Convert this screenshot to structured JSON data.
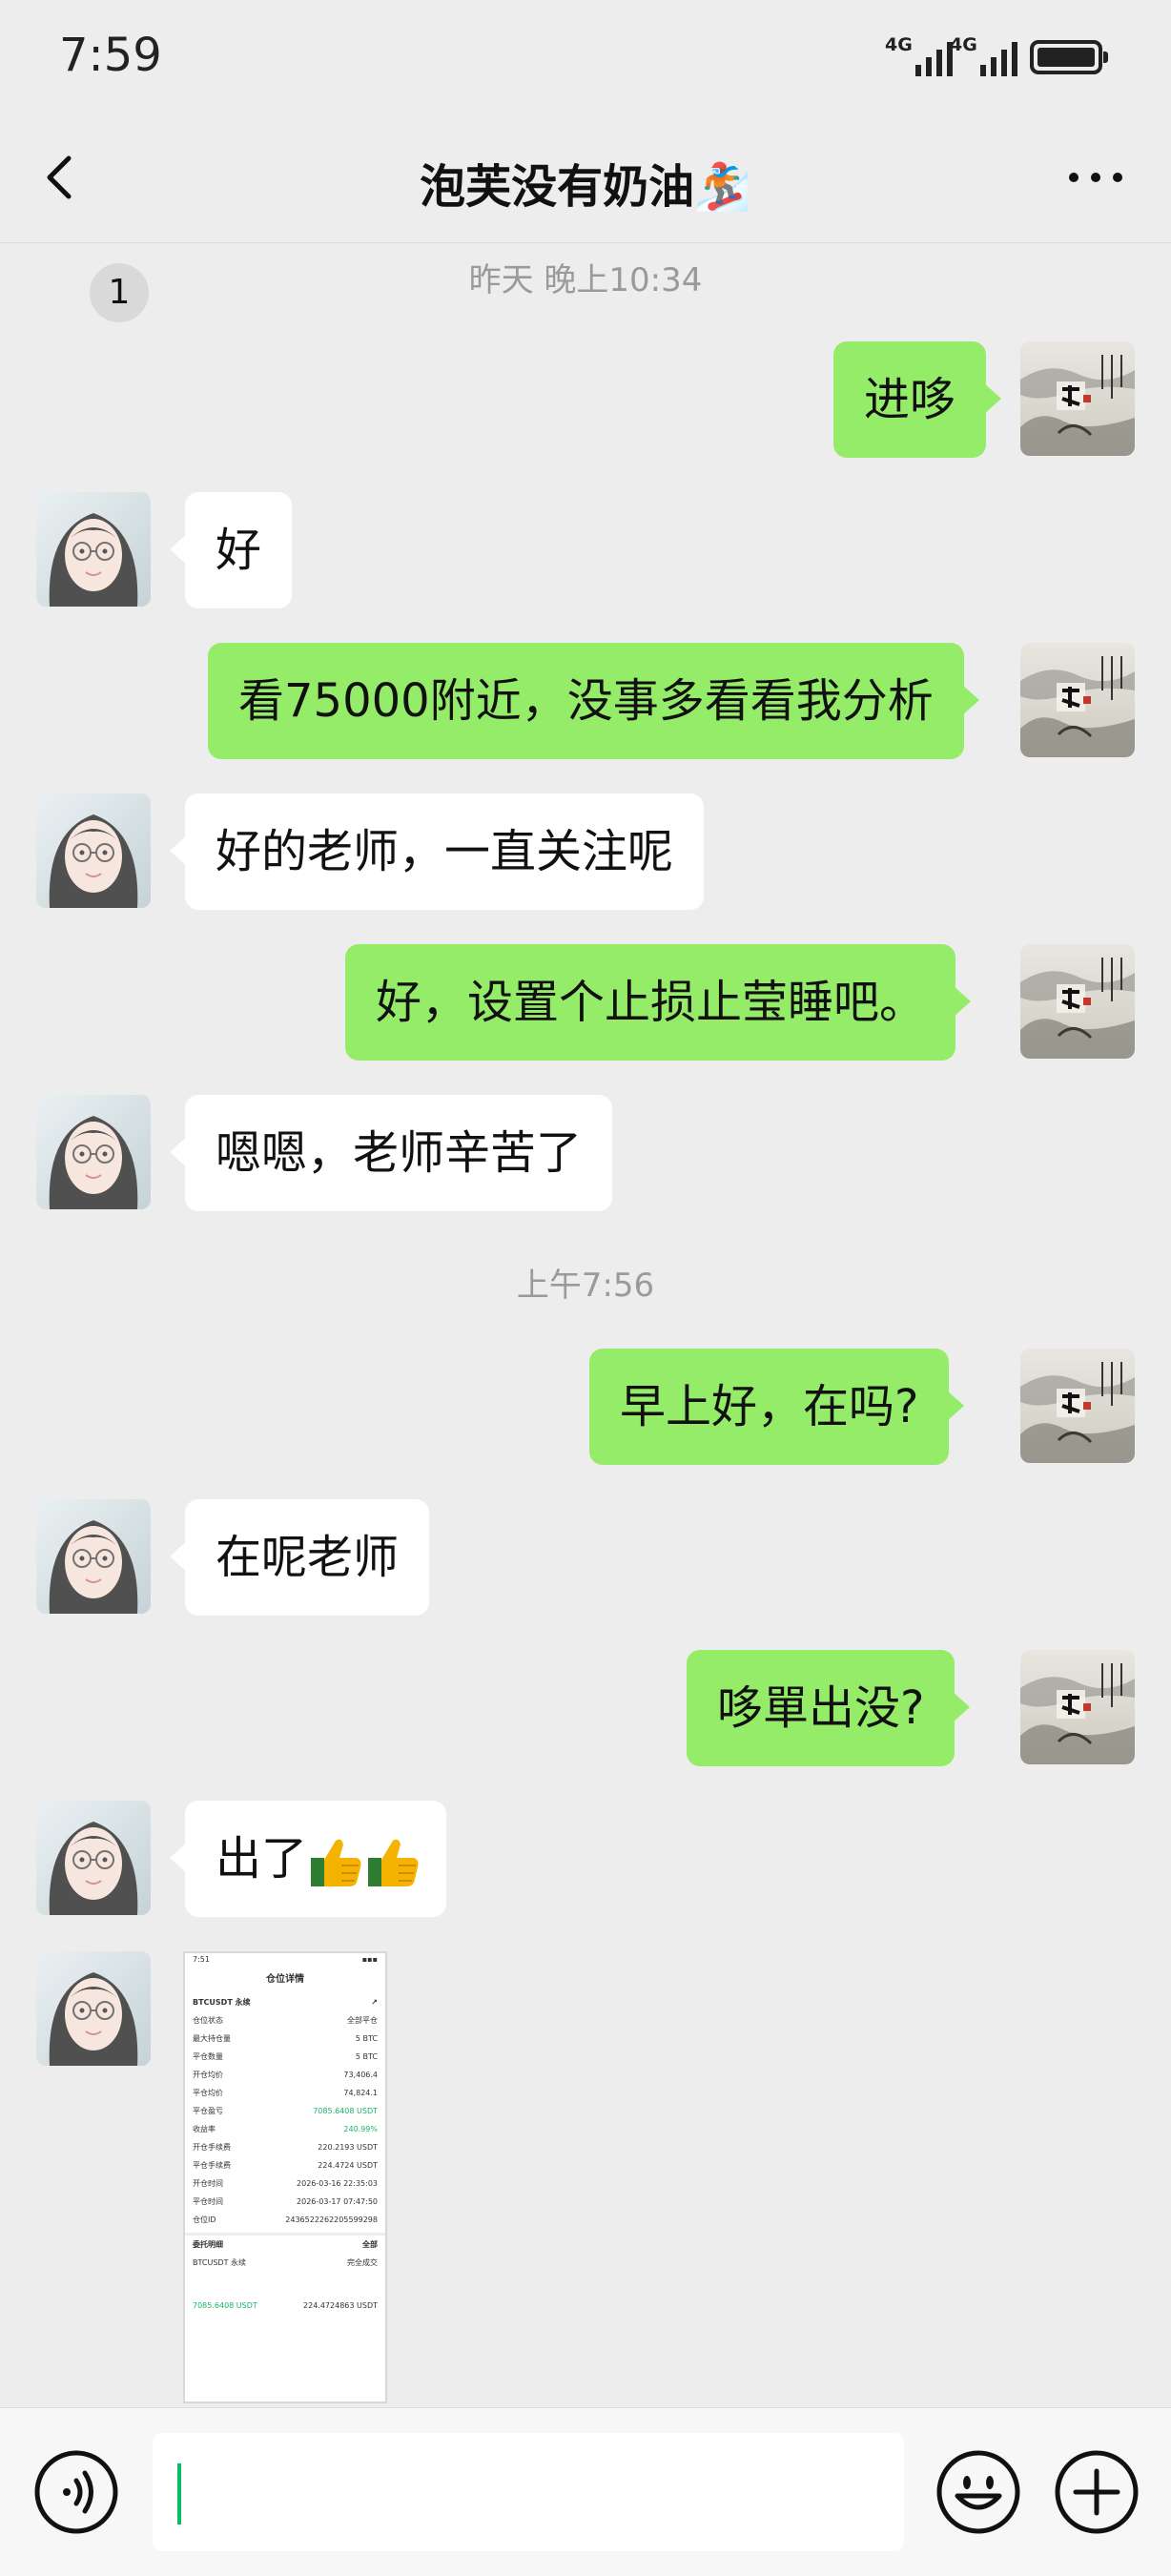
{
  "status_bar": {
    "time": "7:59",
    "network_1": "4G",
    "network_2": "4G"
  },
  "header": {
    "unread_count": "1",
    "title": "泡芙没有奶油🏂"
  },
  "chat": {
    "timestamps": [
      "昨天 晚上10:34",
      "上午7:56"
    ],
    "messages": [
      {
        "sender": "me",
        "text": "进哆"
      },
      {
        "sender": "them",
        "text": "好"
      },
      {
        "sender": "me",
        "text": "看75000附近，没事多看看我分析"
      },
      {
        "sender": "them",
        "text": "好的老师，一直关注呢"
      },
      {
        "sender": "me",
        "text": "好，设置个止损止莹睡吧。"
      },
      {
        "sender": "them",
        "text": "嗯嗯，老师辛苦了"
      },
      {
        "sender": "me",
        "text": "早上好，在吗?"
      },
      {
        "sender": "them",
        "text": "在呢老师"
      },
      {
        "sender": "me",
        "text": "哆單出没?"
      },
      {
        "sender": "them",
        "text": "出了"
      }
    ],
    "screenshot": {
      "time": "7:51",
      "title": "仓位详情",
      "symbol": "BTCUSDT 永续",
      "rows": [
        [
          "仓位状态",
          "全部平仓"
        ],
        [
          "最大持仓量",
          "5 BTC"
        ],
        [
          "平仓数量",
          "5 BTC"
        ],
        [
          "开仓均价",
          "73,406.4"
        ],
        [
          "平仓均价",
          "74,824.1"
        ],
        [
          "平仓盈亏",
          "7085.6408 USDT"
        ],
        [
          "收益率",
          "240.99%"
        ],
        [
          "开仓手续费",
          "220.2193 USDT"
        ],
        [
          "平仓手续费",
          "224.4724 USDT"
        ],
        [
          "开仓时间",
          "2026-03-16 22:35:03"
        ],
        [
          "平仓时间",
          "2026-03-17 07:47:50"
        ],
        [
          "仓位ID",
          "2436522262205599298"
        ]
      ],
      "footer": [
        "委托明细",
        "全部",
        "BTCUSDT 永续",
        "完全成交",
        "7085.6408 USDT",
        "224.4724863 USDT"
      ]
    }
  },
  "colors": {
    "my_bubble": "#95ec69",
    "their_bubble": "#ffffff",
    "background": "#ededed",
    "caret": "#07c160"
  },
  "icons": [
    "back-arrow-icon",
    "more-icon",
    "voice-icon",
    "emoji-icon",
    "plus-icon",
    "thumbs-up-icon"
  ]
}
